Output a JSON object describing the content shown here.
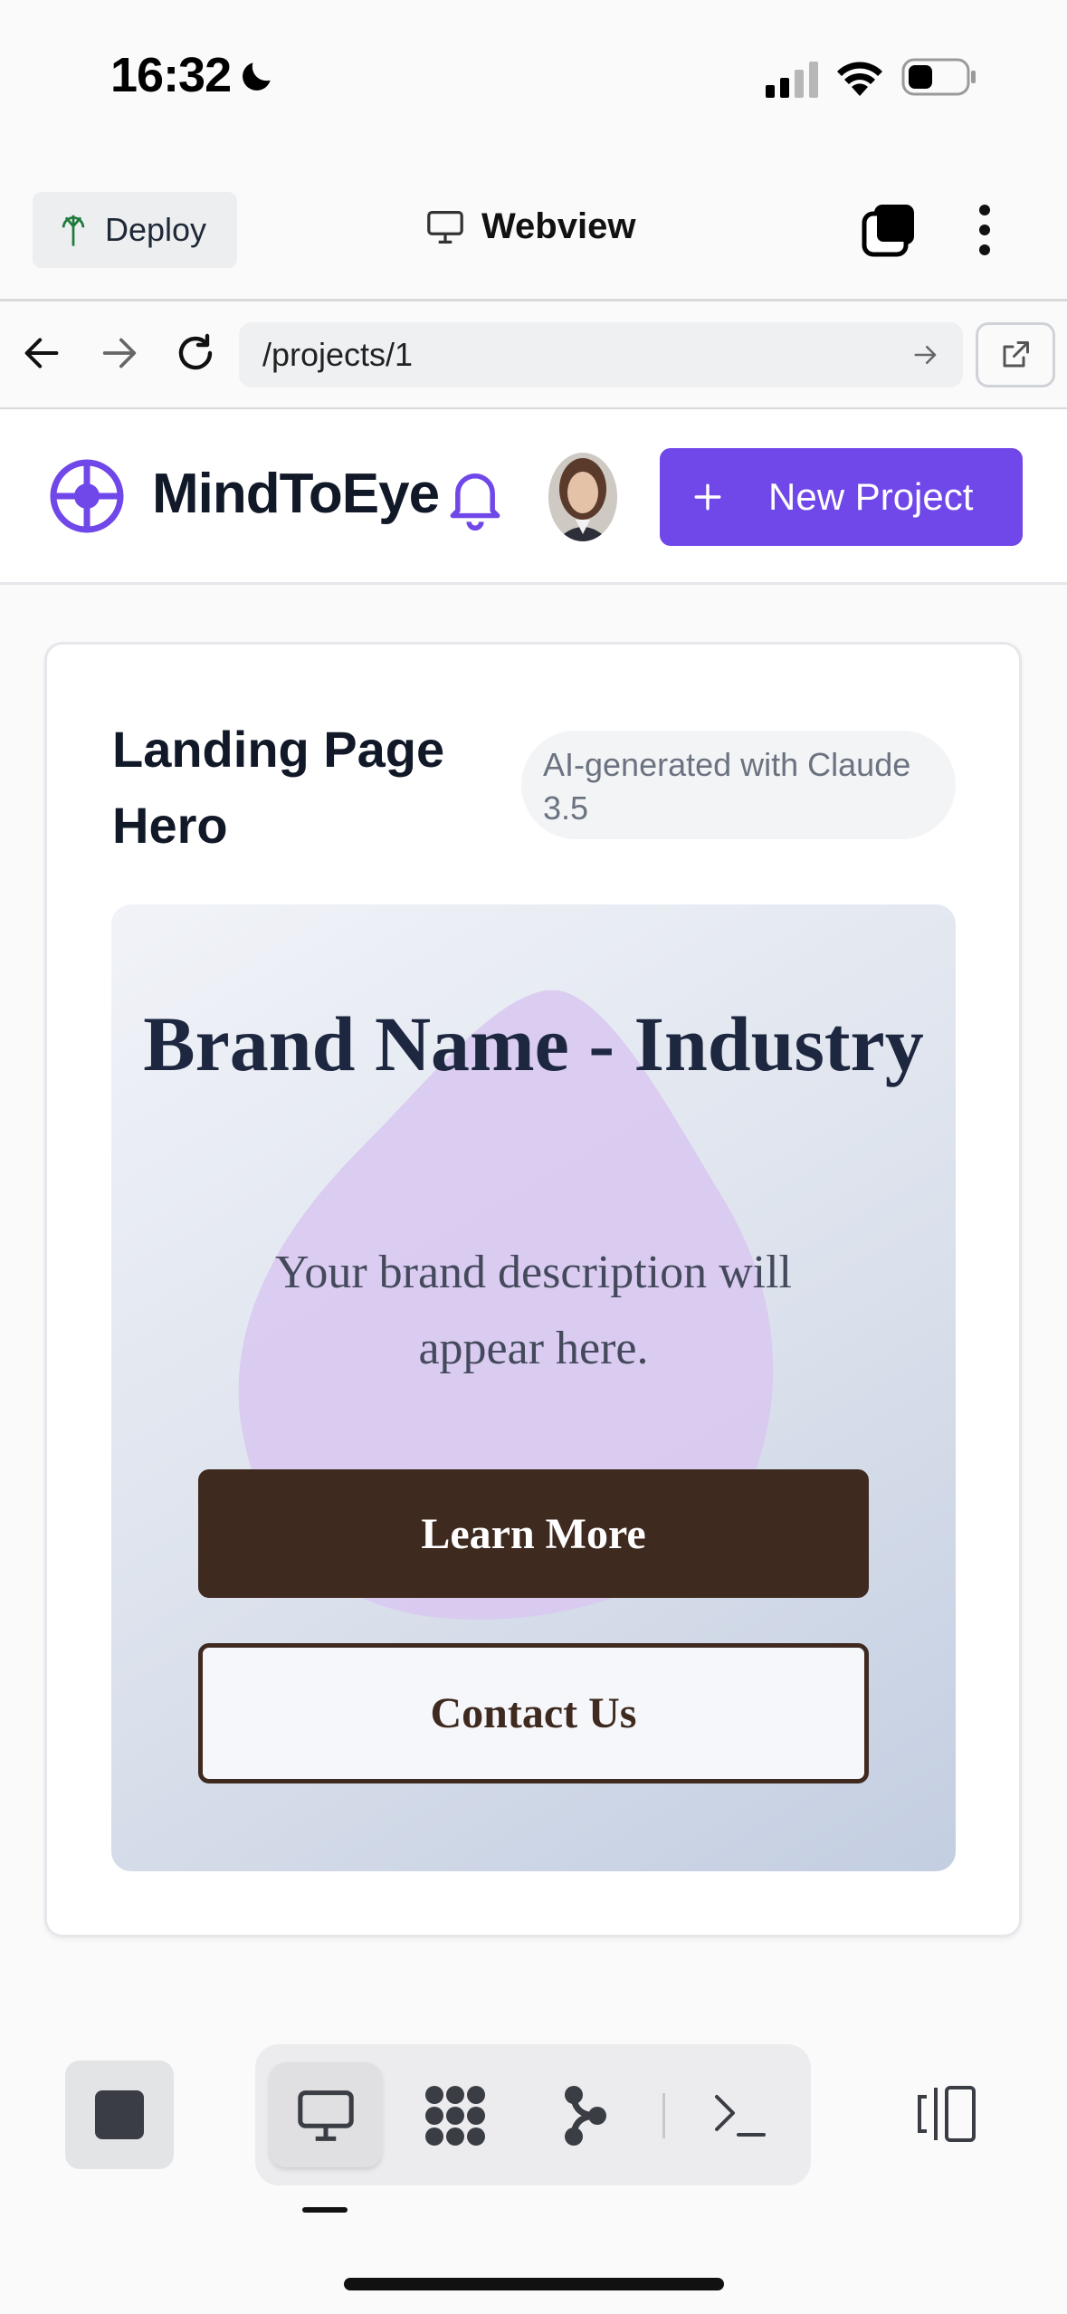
{
  "status_bar": {
    "time": "16:32"
  },
  "toolbar": {
    "deploy_label": "Deploy",
    "webview_label": "Webview"
  },
  "url_bar": {
    "value": "/projects/1"
  },
  "app_header": {
    "app_name": "MindToEye",
    "new_project_label": "New Project"
  },
  "project_card": {
    "title": "Landing Page Hero",
    "badge": "AI-generated with Claude 3.5",
    "preview": {
      "hero_title": "Brand Name - Industry",
      "description": "Your brand description will appear here.",
      "primary_cta": "Learn More",
      "secondary_cta": "Contact Us"
    }
  },
  "colors": {
    "accent": "#7047e8",
    "cta_dark": "#3f2a20",
    "blob": "#d9c9f1"
  },
  "bottom_tools": [
    "stop-icon",
    "desktop-icon",
    "workflow-icon",
    "git-icon",
    "terminal-icon",
    "panel-icon"
  ]
}
